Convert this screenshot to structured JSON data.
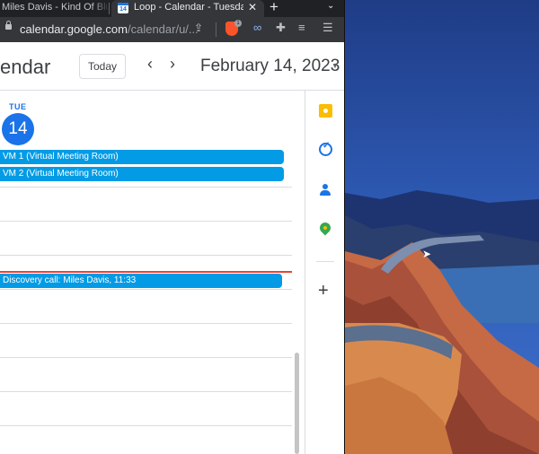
{
  "browser": {
    "tabs": [
      {
        "title": "Miles Davis - Kind Of Blue",
        "active": false
      },
      {
        "title": "Loop - Calendar - Tuesday",
        "active": true,
        "favicon_text": "14"
      }
    ],
    "new_tab_label": "+",
    "tab_list_chevron": "⌄",
    "close_label": "✕",
    "url_host": "calendar.google.com",
    "url_path": "/calendar/u/...",
    "brave_badge": "1"
  },
  "calendar": {
    "app_title": "endar",
    "today_label": "Today",
    "prev_label": "‹",
    "next_label": "›",
    "date_title": "February 14, 2023",
    "date_dropdown": "▼",
    "day_of_week": "TUE",
    "day_number": "14",
    "events": [
      {
        "label": "VM 1 (Virtual Meeting Room)"
      },
      {
        "label": "VM 2 (Virtual Meeting Room)"
      },
      {
        "label": "Discovery call: Miles Davis, 11:33"
      }
    ]
  },
  "side_panel": {
    "items": [
      "keep-icon",
      "tasks-icon",
      "contacts-icon",
      "maps-icon"
    ],
    "add_label": "+"
  },
  "colors": {
    "event_blue": "#039be5",
    "today_blue": "#1a73e8",
    "now_red": "#ea4335"
  }
}
